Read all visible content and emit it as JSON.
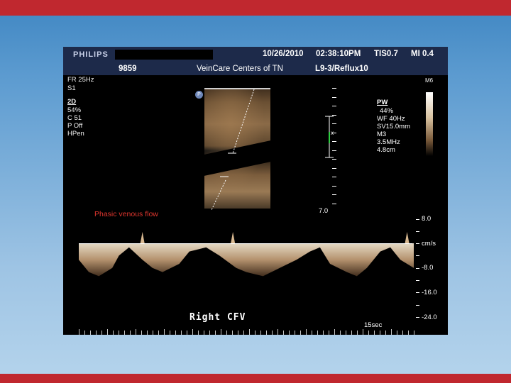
{
  "header": {
    "logo": "PHILIPS",
    "date": "10/26/2010",
    "time": "02:38:10PM",
    "tis": "TIS0.7",
    "mi": "MI 0.4",
    "id": "9859",
    "institution": "VeinCare Centers of TN",
    "probe_preset": "L9-3/Reflux10"
  },
  "left_params": [
    "FR 25Hz",
    "S1"
  ],
  "mode_2d": {
    "label": "2D",
    "lines": [
      "54%",
      "C 51",
      "P Off",
      "HPen"
    ]
  },
  "probe_marker": "P",
  "top_right": "M6",
  "pw": {
    "label": "PW",
    "lines": [
      "44%",
      "WF 40Hz",
      "SV15.0mm",
      "M3",
      "3.5MHz",
      "4.8cm"
    ]
  },
  "depth_label": "7.0",
  "annotation": "Phasic venous flow",
  "velocity_scale": {
    "top": "8.0",
    "unit": "cm/s",
    "labels": [
      "-8.0",
      "-16.0",
      "-24.0"
    ]
  },
  "waveform": {
    "x": [
      0,
      0.03,
      0.06,
      0.1,
      0.12,
      0.15,
      0.19,
      0.22,
      0.25,
      0.3,
      0.33,
      0.38,
      0.42,
      0.47,
      0.5,
      0.55,
      0.6,
      0.65,
      0.69,
      0.72,
      0.75,
      0.8,
      0.83,
      0.86,
      0.9,
      0.93,
      0.96,
      1.0
    ],
    "depth_cm_s": [
      -8,
      -14,
      -16,
      -12,
      -6,
      -2,
      -8,
      -12,
      -14,
      -10,
      -4,
      -2,
      -6,
      -12,
      -14,
      -16,
      -12,
      -8,
      -4,
      -2,
      -10,
      -14,
      -16,
      -12,
      -4,
      -2,
      -8,
      -12
    ]
  },
  "label_bottom": "Right   CFV",
  "time_label": "15sec",
  "colors": {
    "top_bar": "#c0282f",
    "annotation": "#e0362e",
    "header_bg": "#1d2a4a"
  }
}
